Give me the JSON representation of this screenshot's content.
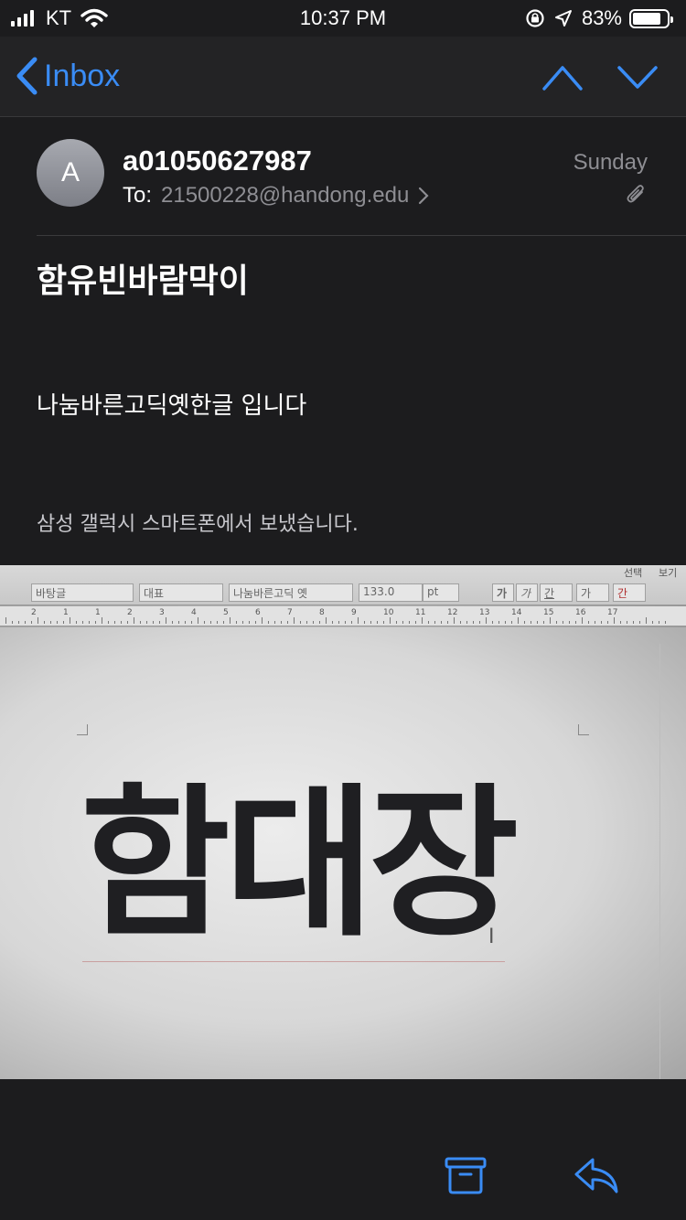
{
  "status_bar": {
    "carrier": "KT",
    "time": "10:37 PM",
    "battery": "83%",
    "battery_level": 0.83
  },
  "nav": {
    "back_label": "Inbox"
  },
  "message": {
    "avatar_initial": "A",
    "sender": "a01050627987",
    "to_label": "To:",
    "to_address": "21500228@handong.edu",
    "date": "Sunday",
    "subject": "함유빈바람막이",
    "body": "나눔바른고딕옛한글 입니다",
    "signature": "삼성 갤럭시 스마트폰에서 보냈습니다."
  },
  "attachment": {
    "toolbar": {
      "style": "바탕글",
      "font_lang": "대표",
      "font_name": "나눔바른고딕 옛",
      "font_size": "133.0",
      "unit": "pt",
      "bold": "가",
      "italic": "가",
      "underline": "간",
      "strike": "가",
      "color": "간",
      "menu_select": "선택",
      "menu_view": "보기"
    },
    "ruler_numbers": [
      "2",
      "1",
      "1",
      "2",
      "3",
      "4",
      "5",
      "6",
      "7",
      "8",
      "9",
      "10",
      "11",
      "12",
      "13",
      "14",
      "15",
      "16",
      "17"
    ],
    "document_text": "함대장"
  },
  "colors": {
    "accent": "#3a8cf5",
    "background": "#1c1c1e",
    "secondary_text": "#8e8e93"
  }
}
